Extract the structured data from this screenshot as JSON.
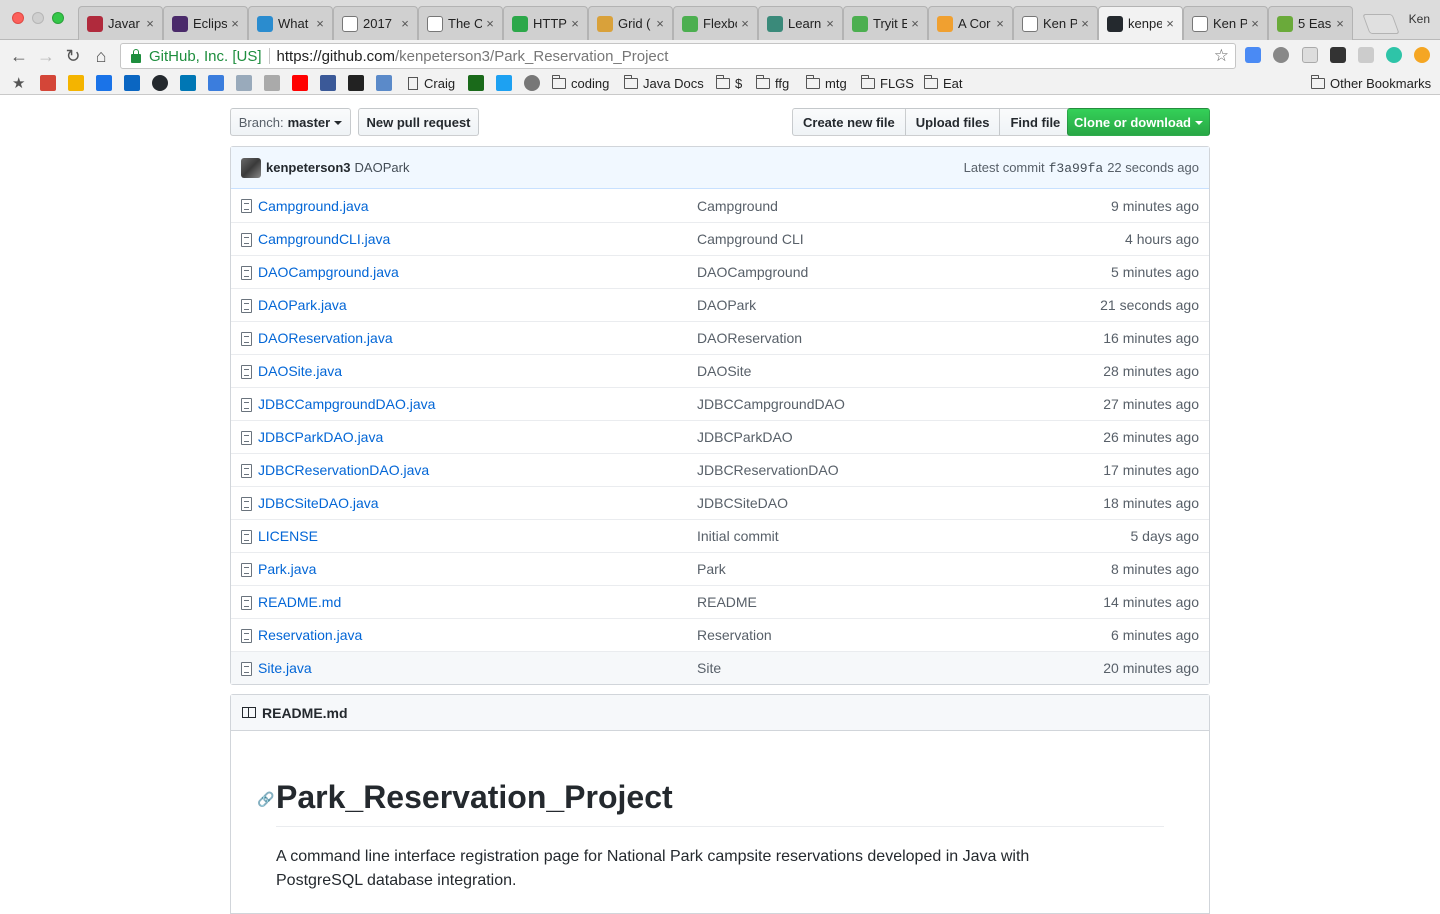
{
  "browser": {
    "tabs": [
      {
        "title": "Javar",
        "fav_color": "#b02a3c",
        "active": false
      },
      {
        "title": "Eclips",
        "fav_color": "#4a2a6a",
        "active": false
      },
      {
        "title": "What",
        "fav_color": "#2a8ccf",
        "active": false
      },
      {
        "title": "2017",
        "fav_color": "#ffffff",
        "active": false
      },
      {
        "title": "The C",
        "fav_color": "#ffffff",
        "active": false
      },
      {
        "title": "HTTP",
        "fav_color": "#2ca84a",
        "active": false
      },
      {
        "title": "Grid (",
        "fav_color": "#d9a13a",
        "active": false
      },
      {
        "title": "Flexbo",
        "fav_color": "#4caf50",
        "active": false
      },
      {
        "title": "Learn",
        "fav_color": "#3a8a7a",
        "active": false
      },
      {
        "title": "Tryit E",
        "fav_color": "#4caf50",
        "active": false
      },
      {
        "title": "A Cor",
        "fav_color": "#f0a030",
        "active": false
      },
      {
        "title": "Ken P",
        "fav_color": "#ffffff",
        "active": false
      },
      {
        "title": "kenpe",
        "fav_color": "#24292e",
        "active": true
      },
      {
        "title": "Ken P",
        "fav_color": "#ffffff",
        "active": false
      },
      {
        "title": "5 Eas",
        "fav_color": "#6aaa3a",
        "active": false
      }
    ],
    "profile_name": "Ken",
    "secure_label": "GitHub, Inc. [US]",
    "url_host": "https://github.com",
    "url_path": "/kenpeterson3/Park_Reservation_Project",
    "bookmarks": {
      "craig": "Craig",
      "coding": "coding",
      "java_docs": "Java Docs",
      "dollar": "$",
      "ffg": "ffg",
      "mtg": "mtg",
      "flgs": "FLGS",
      "eat": "Eat",
      "other": "Other Bookmarks"
    }
  },
  "repo": {
    "branch_label": "Branch:",
    "branch_name": "master",
    "new_pr": "New pull request",
    "create_file": "Create new file",
    "upload_files": "Upload files",
    "find_file": "Find file",
    "clone": "Clone or download",
    "commit": {
      "author": "kenpeterson3",
      "message": "DAOPark",
      "latest_label": "Latest commit",
      "sha": "f3a99fa",
      "age": "22 seconds ago"
    },
    "files": [
      {
        "name": "Campground.java",
        "message": "Campground",
        "age": "9 minutes ago"
      },
      {
        "name": "CampgroundCLI.java",
        "message": "Campground CLI",
        "age": "4 hours ago"
      },
      {
        "name": "DAOCampground.java",
        "message": "DAOCampground",
        "age": "5 minutes ago"
      },
      {
        "name": "DAOPark.java",
        "message": "DAOPark",
        "age": "21 seconds ago"
      },
      {
        "name": "DAOReservation.java",
        "message": "DAOReservation",
        "age": "16 minutes ago"
      },
      {
        "name": "DAOSite.java",
        "message": "DAOSite",
        "age": "28 minutes ago"
      },
      {
        "name": "JDBCCampgroundDAO.java",
        "message": "JDBCCampgroundDAO",
        "age": "27 minutes ago"
      },
      {
        "name": "JDBCParkDAO.java",
        "message": "JDBCParkDAO",
        "age": "26 minutes ago"
      },
      {
        "name": "JDBCReservationDAO.java",
        "message": "JDBCReservationDAO",
        "age": "17 minutes ago"
      },
      {
        "name": "JDBCSiteDAO.java",
        "message": "JDBCSiteDAO",
        "age": "18 minutes ago"
      },
      {
        "name": "LICENSE",
        "message": "Initial commit",
        "age": "5 days ago"
      },
      {
        "name": "Park.java",
        "message": "Park",
        "age": "8 minutes ago"
      },
      {
        "name": "README.md",
        "message": "README",
        "age": "14 minutes ago"
      },
      {
        "name": "Reservation.java",
        "message": "Reservation",
        "age": "6 minutes ago"
      },
      {
        "name": "Site.java",
        "message": "Site",
        "age": "20 minutes ago"
      }
    ],
    "readme": {
      "filename": "README.md",
      "title": "Park_Reservation_Project",
      "body": "A command line interface registration page for National Park campsite reservations developed in Java with PostgreSQL database integration."
    }
  }
}
